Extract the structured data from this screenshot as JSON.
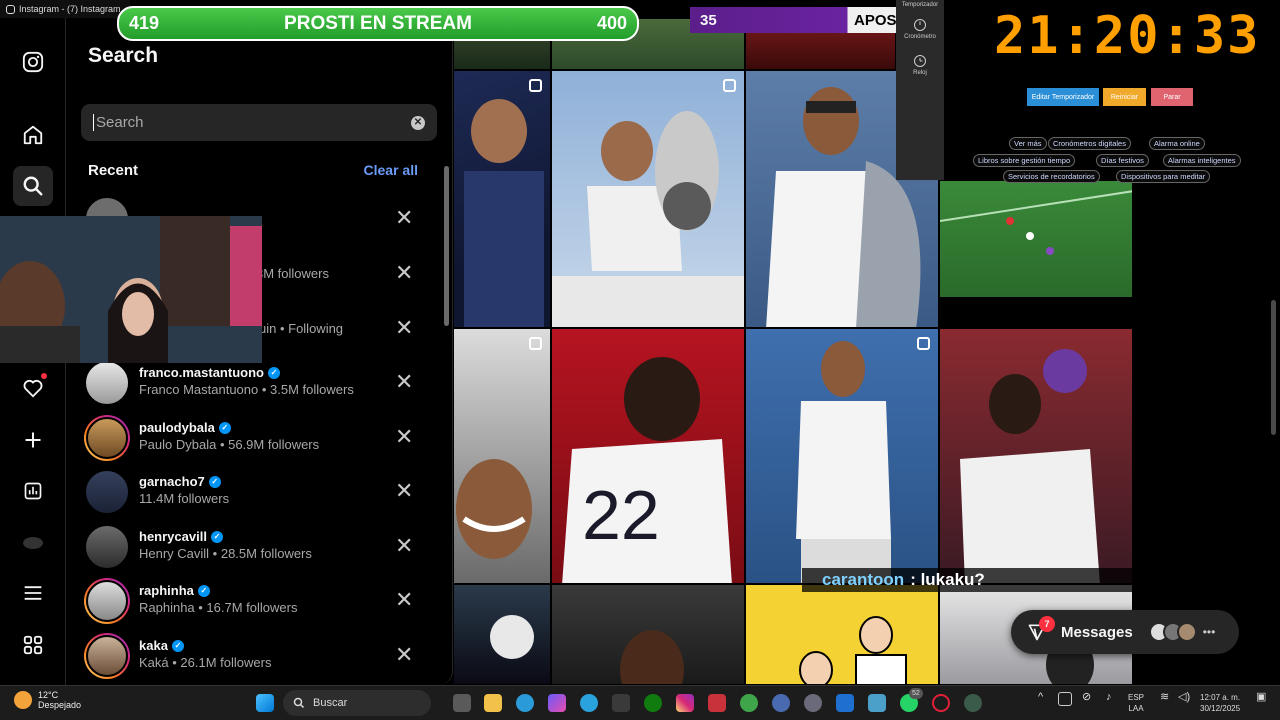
{
  "window": {
    "title": "Instagram - (7) Instagram"
  },
  "overlay": {
    "left_score": "419",
    "stream_title": "PROSTI EN STREAM",
    "right_score": "400",
    "purple_number": "35",
    "purple_label": "APOS"
  },
  "timer": {
    "side_top": "Temporizador",
    "side_cronometro": "Cronómetro",
    "side_reloj": "Reloj",
    "display": "21:20:33",
    "buttons": [
      "Editar Temporizador",
      "Reiniciar",
      "Parar"
    ],
    "links": [
      "Ver más",
      "Cronómetros digitales",
      "Alarma online",
      "Libros sobre gestión tiempo",
      "Días festivos",
      "Alarmas inteligentes",
      "Servicios de recordatorios",
      "Dispositivos para meditar"
    ]
  },
  "search_panel": {
    "title": "Search",
    "placeholder": "Search",
    "recent_label": "Recent",
    "clear_all": "Clear all",
    "items": [
      {
        "username": "",
        "sub": ""
      },
      {
        "username": "",
        "sub": "3M followers"
      },
      {
        "username": "",
        "sub": "uin • Following"
      },
      {
        "username": "franco.mastantuono",
        "sub": "Franco Mastantuono • 3.5M followers",
        "verified": true
      },
      {
        "username": "paulodybala",
        "sub": "Paulo Dybala • 56.9M followers",
        "verified": true
      },
      {
        "username": "garnacho7",
        "sub": "11.4M followers",
        "verified": true
      },
      {
        "username": "henrycavill",
        "sub": "Henry Cavill • 28.5M followers",
        "verified": true
      },
      {
        "username": "raphinha",
        "sub": "Raphinha • 16.7M followers",
        "verified": true
      },
      {
        "username": "kaka",
        "sub": "Kaká • 26.1M followers",
        "verified": true
      }
    ]
  },
  "chat": {
    "user": "carantoon",
    "message": ": lukaku?"
  },
  "messages": {
    "label": "Messages",
    "badge": "7"
  },
  "taskbar": {
    "temperature": "12°C",
    "weather": "Despejado",
    "search": "Buscar",
    "lang_top": "ESP",
    "lang_bottom": "LAA",
    "time": "12:07 a. m.",
    "date": "30/12/2025",
    "badge": "52"
  }
}
